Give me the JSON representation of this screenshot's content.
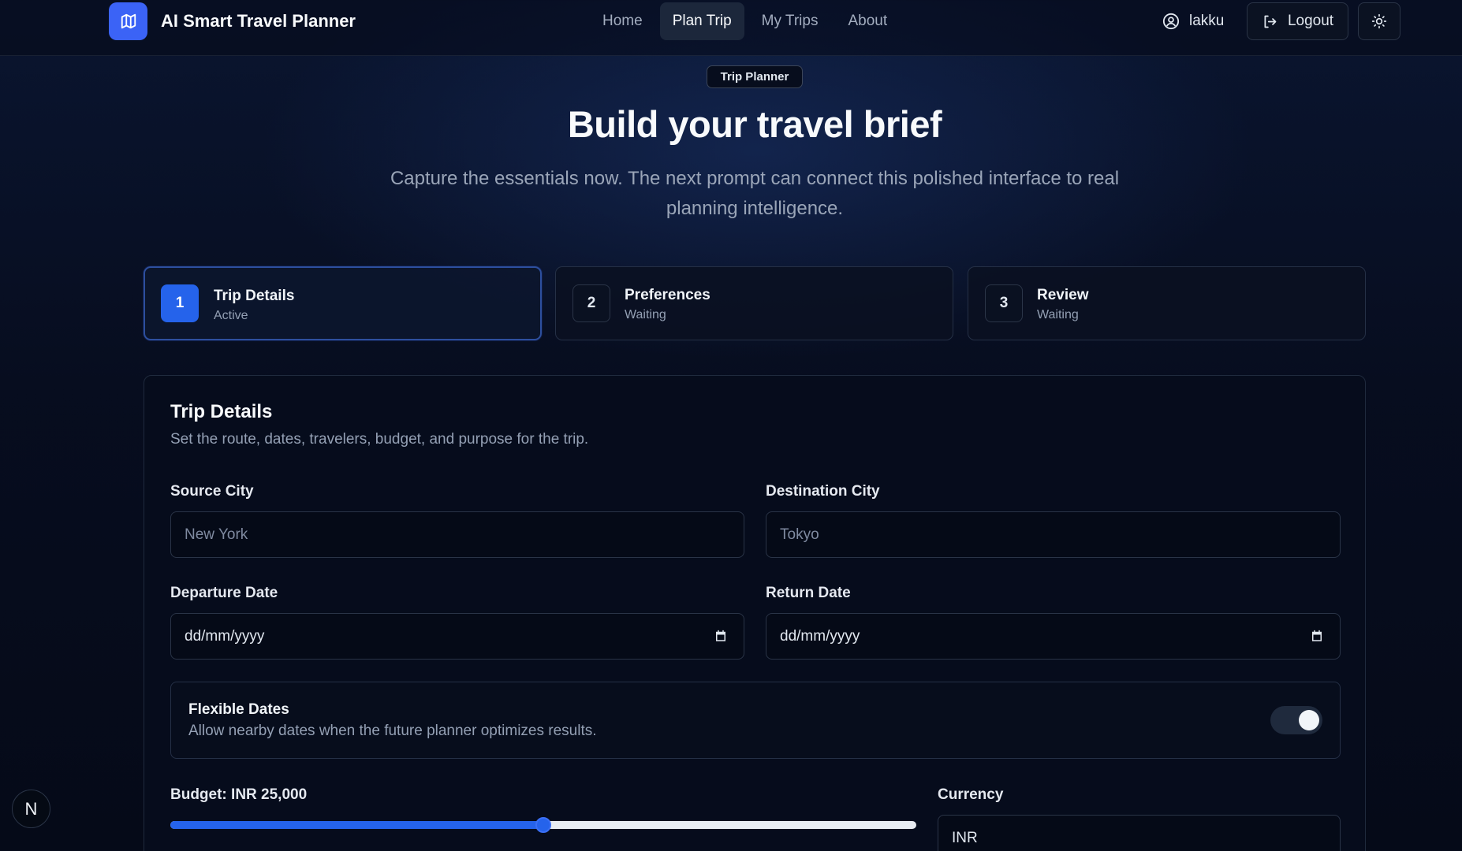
{
  "header": {
    "brand_title": "AI Smart Travel Planner",
    "brand_icon": "map-icon",
    "nav": [
      {
        "label": "Home",
        "active": false
      },
      {
        "label": "Plan Trip",
        "active": true
      },
      {
        "label": "My Trips",
        "active": false
      },
      {
        "label": "About",
        "active": false
      }
    ],
    "user_name": "lakku",
    "logout_label": "Logout",
    "theme_icon": "sun-icon"
  },
  "hero": {
    "pill": "Trip Planner",
    "title": "Build your travel brief",
    "subtitle": "Capture the essentials now. The next prompt can connect this polished interface to real planning intelligence."
  },
  "steps": [
    {
      "number": "1",
      "title": "Trip Details",
      "status": "Active"
    },
    {
      "number": "2",
      "title": "Preferences",
      "status": "Waiting"
    },
    {
      "number": "3",
      "title": "Review",
      "status": "Waiting"
    }
  ],
  "form": {
    "title": "Trip Details",
    "description": "Set the route, dates, travelers, budget, and purpose for the trip.",
    "source_label": "Source City",
    "source_placeholder": "New York",
    "destination_label": "Destination City",
    "destination_placeholder": "Tokyo",
    "departure_label": "Departure Date",
    "departure_value": "dd/mm/yyyy",
    "return_label": "Return Date",
    "return_value": "dd/mm/yyyy",
    "flexible_title": "Flexible Dates",
    "flexible_desc": "Allow nearby dates when the future planner optimizes results.",
    "flexible_on": true,
    "budget_label": "Budget: INR 25,000",
    "budget_fraction": 0.5,
    "currency_label": "Currency",
    "currency_value": "INR"
  },
  "badge": "N",
  "colors": {
    "accent": "#2563eb",
    "brand": "#3b63f6",
    "background": "#070d1f"
  }
}
